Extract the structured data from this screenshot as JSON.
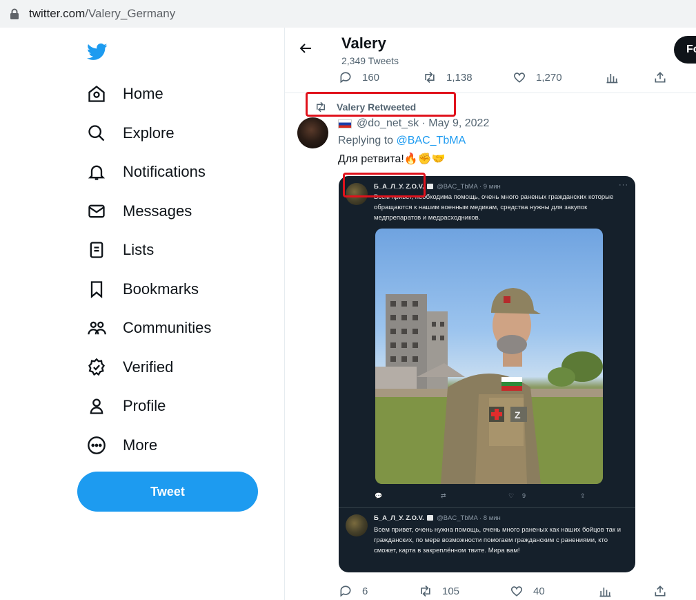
{
  "browser": {
    "url_host": "twitter.com",
    "url_path": "/Valery_Germany"
  },
  "sidebar": {
    "items": [
      {
        "label": "Home",
        "icon": "home-icon"
      },
      {
        "label": "Explore",
        "icon": "search-icon"
      },
      {
        "label": "Notifications",
        "icon": "bell-icon"
      },
      {
        "label": "Messages",
        "icon": "mail-icon"
      },
      {
        "label": "Lists",
        "icon": "list-icon"
      },
      {
        "label": "Bookmarks",
        "icon": "bookmark-icon"
      },
      {
        "label": "Communities",
        "icon": "people-icon"
      },
      {
        "label": "Verified",
        "icon": "verified-icon"
      },
      {
        "label": "Profile",
        "icon": "person-icon"
      },
      {
        "label": "More",
        "icon": "more-circle-icon"
      }
    ],
    "tweet_button": "Tweet"
  },
  "header": {
    "name": "Valery",
    "tweet_count": "2,349 Tweets",
    "follow_label": "Fo"
  },
  "prev_actions": {
    "replies": "160",
    "retweets": "1,138",
    "likes": "1,270"
  },
  "retweet": {
    "label": "Valery Retweeted",
    "author_handle": "@do_net_sk · May 9, 2022",
    "replying_prefix": "Replying to",
    "replying_handle": "@BAC_TbMA",
    "text": "Для ретвита!🔥✊🤝"
  },
  "embedded": {
    "post1": {
      "name": "Б_А_Л_У. Z.O.V.",
      "handle_time": "@BAC_TbMA · 9 мин",
      "text": "Всем привет, необходима помощь, очень много раненых гражданских которые обращаются к нашим военным медикам, средства нужны для закупок медпрепаратов и медрасходников.",
      "likes": "9"
    },
    "post2": {
      "name": "Б_А_Л_У. Z.O.V.",
      "handle_time": "@BAC_TbMA · 8 мин",
      "text": "Всем привет, очень нужна помощь, очень много раненых как наших бойцов так и гражданских, по мере возможности помогаем гражданским с ранениями, кто сможет, карта в закреплённом твите. Мира вам!"
    }
  },
  "actions": {
    "replies": "6",
    "retweets": "105",
    "likes": "40"
  },
  "colors": {
    "accent": "#1d9bf0",
    "annotation_red": "#e0121c",
    "embedded_bg": "#15202b"
  }
}
